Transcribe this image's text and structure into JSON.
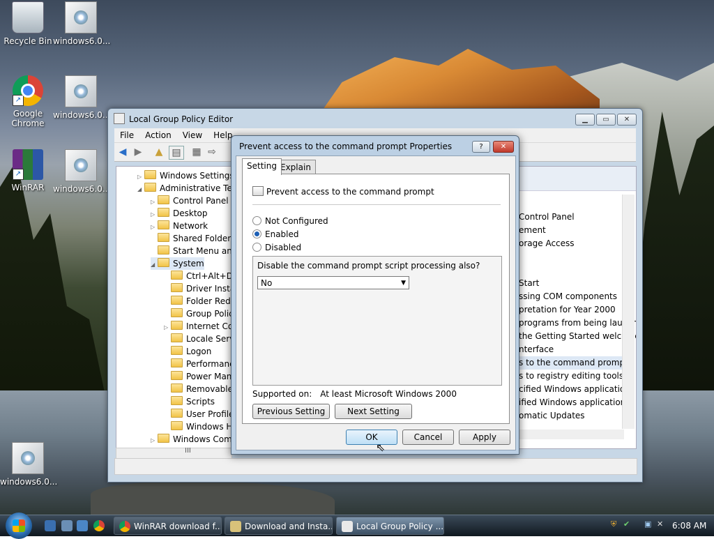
{
  "desktop": {
    "icons": [
      {
        "label": "Recycle Bin"
      },
      {
        "label": "windows6.0..."
      },
      {
        "label": "Google Chrome"
      },
      {
        "label": "windows6.0..."
      },
      {
        "label": "WinRAR"
      },
      {
        "label": "windows6.0..."
      },
      {
        "label": "windows6.0..."
      }
    ]
  },
  "main_window": {
    "title": "Local Group Policy Editor",
    "menu": [
      "File",
      "Action",
      "View",
      "Help"
    ],
    "tree": [
      {
        "label": "Windows Settings"
      },
      {
        "label": "Administrative Tem"
      },
      {
        "label": "Control Panel"
      },
      {
        "label": "Desktop"
      },
      {
        "label": "Network"
      },
      {
        "label": "Shared Folders"
      },
      {
        "label": "Start Menu and"
      },
      {
        "label": "System"
      },
      {
        "label": "Ctrl+Alt+De"
      },
      {
        "label": "Driver Instal"
      },
      {
        "label": "Folder Redir"
      },
      {
        "label": "Group Polic"
      },
      {
        "label": "Internet Cor"
      },
      {
        "label": "Locale Servi"
      },
      {
        "label": "Logon"
      },
      {
        "label": "Performanc"
      },
      {
        "label": "Power Mana"
      },
      {
        "label": "Removable"
      },
      {
        "label": "Scripts"
      },
      {
        "label": "User Profiles"
      },
      {
        "label": "Windows He"
      },
      {
        "label": "Windows Comp"
      }
    ],
    "tree_scroll_text": "III",
    "settings_list": [
      "Control Panel",
      "ement",
      "orage Access",
      "Start",
      "ssing COM components",
      "pretation for Year 2000",
      "programs from being launch",
      "the Getting Started welcome",
      "nterface",
      "s to the command prompt",
      "s to registry editing tools",
      "cified Windows applications",
      "ified Windows applications",
      "omatic Updates"
    ]
  },
  "dialog": {
    "title": "Prevent access to the command prompt Properties",
    "help_label": "?",
    "close_label": "✕",
    "tabs": [
      "Setting",
      "Explain"
    ],
    "policy_name": "Prevent access to the command prompt",
    "radios": [
      {
        "label": "Not Configured",
        "checked": false
      },
      {
        "label": "Enabled",
        "checked": true
      },
      {
        "label": "Disabled",
        "checked": false
      }
    ],
    "option_label": "Disable the command prompt script processing also?",
    "option_value": "No",
    "supported_label": "Supported on:",
    "supported_value": "At least Microsoft Windows 2000",
    "prev_button": "Previous Setting",
    "next_button": "Next Setting",
    "ok_button": "OK",
    "cancel_button": "Cancel",
    "apply_button": "Apply"
  },
  "taskbar": {
    "tasks": [
      {
        "label": "WinRAR download f..."
      },
      {
        "label": "Download and Insta..."
      },
      {
        "label": "Local Group Policy ..."
      }
    ],
    "clock": "6:08 AM"
  },
  "colors": {
    "accent": "#1d5fb5",
    "window_frame": "#c7d7e6",
    "taskbar": "#10181f"
  }
}
